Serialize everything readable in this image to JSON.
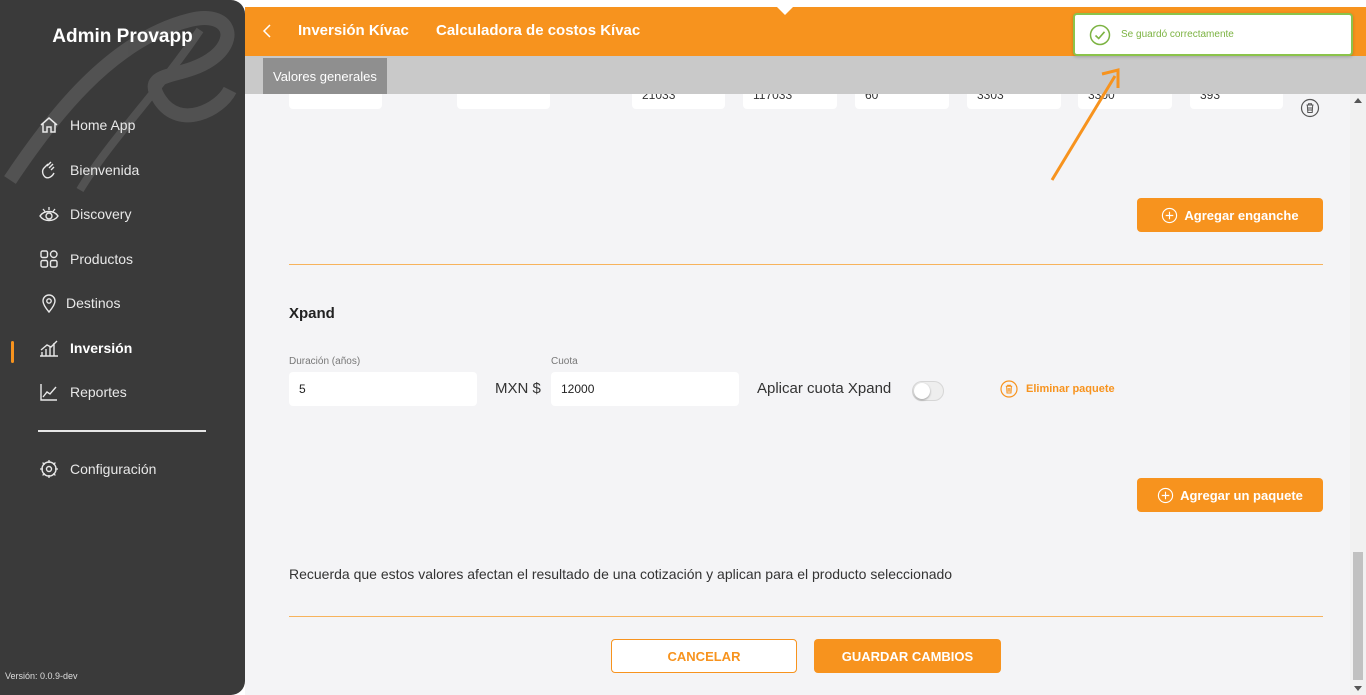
{
  "app": {
    "title": "Admin Provapp",
    "version": "Versión: 0.0.9-dev"
  },
  "sidebar": {
    "items": [
      {
        "label": "Home App",
        "icon": "home-icon"
      },
      {
        "label": "Bienvenida",
        "icon": "waving-hand-icon"
      },
      {
        "label": "Discovery",
        "icon": "eye-icon"
      },
      {
        "label": "Productos",
        "icon": "grid-icon"
      },
      {
        "label": "Destinos",
        "icon": "map-pin-icon"
      },
      {
        "label": "Inversión",
        "icon": "bar-chart-icon",
        "active": true
      },
      {
        "label": "Reportes",
        "icon": "line-chart-icon"
      }
    ],
    "config": {
      "label": "Configuración",
      "icon": "gear-icon"
    }
  },
  "header": {
    "crumb1": "Inversión Kívac",
    "crumb2": "Calculadora de costos Kívac"
  },
  "subtabs": {
    "active": "Valores generales"
  },
  "top_fields": [
    "",
    "",
    "21033",
    "117033",
    "60",
    "3303",
    "3300",
    "393"
  ],
  "buttons": {
    "add_down_payment": "Agregar enganche",
    "add_package": "Agregar un paquete",
    "cancel": "CANCELAR",
    "save": "GUARDAR CAMBIOS"
  },
  "xpand": {
    "title": "Xpand",
    "duration_label": "Duración (años)",
    "duration_value": "5",
    "currency": "MXN $",
    "fee_label": "Cuota",
    "fee_value": "12000",
    "apply_label": "Aplicar cuota Xpand",
    "apply_on": false,
    "delete_label": "Eliminar paquete"
  },
  "note": "Recuerda que estos valores afectan el resultado de una cotización y aplican para el producto seleccionado",
  "toast": {
    "message": "Se guardó correctamente"
  },
  "colors": {
    "accent": "#f7931e",
    "sidebar": "#3a3a3a",
    "success": "#8bc34a"
  }
}
